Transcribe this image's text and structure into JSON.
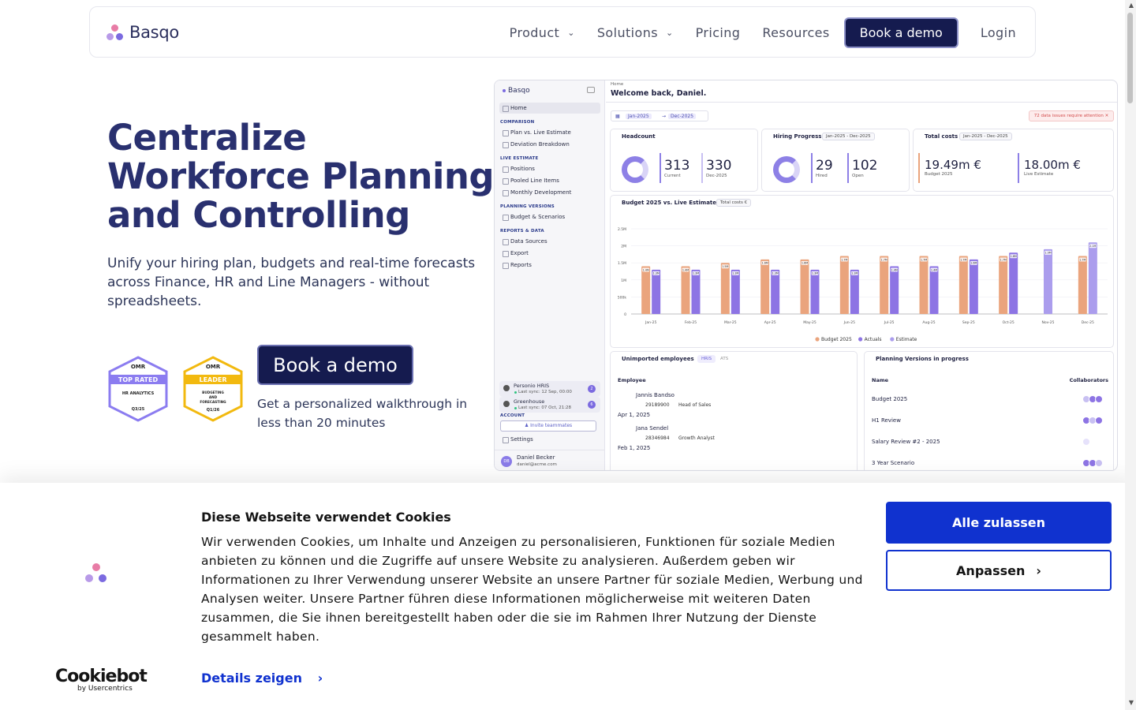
{
  "nav": {
    "brand": "Basqo",
    "items": [
      "Product",
      "Solutions",
      "Pricing",
      "Resources"
    ],
    "demo_label": "Book a demo",
    "login_label": "Login"
  },
  "hero": {
    "title": "Centralize Workforce Planning and Controlling",
    "subtitle": "Unify your hiring plan, budgets and real-time forecasts across Finance, HR and Line Managers - without spreadsheets.",
    "cta_label": "Book a demo",
    "cta_note": "Get a personalized walkthrough in less than 20 minutes",
    "badges": [
      {
        "brand": "OMR",
        "title": "TOP RATED",
        "category": "HR ANALYTICS",
        "period": "Q3/25",
        "color": "#8b7cf0"
      },
      {
        "brand": "OMR",
        "title": "LEADER",
        "category": "BUDGETING AND FORECASTING",
        "period": "Q1/26",
        "color": "#f2b90f"
      }
    ]
  },
  "mock": {
    "brand": "Basqo",
    "sidebar": {
      "home": "Home",
      "sections": [
        {
          "title": "COMPARISON",
          "items": [
            "Plan vs. Live Estimate",
            "Deviation Breakdown"
          ]
        },
        {
          "title": "LIVE ESTIMATE",
          "items": [
            "Positions",
            "Pooled Line Items",
            "Monthly Development"
          ]
        },
        {
          "title": "PLANNING VERSIONS",
          "items": [
            "Budget & Scenarios"
          ]
        },
        {
          "title": "REPORTS & DATA",
          "items": [
            "Data Sources",
            "Export",
            "Reports"
          ]
        }
      ],
      "integrations": [
        {
          "name": "Personio HRIS",
          "sync": "Last sync: 12 Sep, 00:00",
          "count": "2"
        },
        {
          "name": "Greenhouse",
          "sync": "Last sync: 07 Oct, 21:28",
          "count": "6"
        }
      ],
      "account_title": "ACCOUNT",
      "invite_label": "Invite teammates",
      "settings_label": "Settings",
      "user": {
        "initials": "DB",
        "name": "Daniel Becker",
        "email": "daniel@acme.com"
      }
    },
    "breadcrumb": "Home",
    "welcome": "Welcome back, Daniel.",
    "date_from": "Jan-2025",
    "date_to": "Dec-2025",
    "alert": "72 data issues require attention",
    "headcount": {
      "title": "Headcount",
      "current": "313",
      "current_label": "Current",
      "target": "330",
      "target_label": "Dec-2025"
    },
    "hiring": {
      "title": "Hiring Progress",
      "range": "Jan-2025 - Dec-2025",
      "hired": "29",
      "hired_label": "Hired",
      "open": "102",
      "open_label": "Open"
    },
    "costs": {
      "title": "Total costs",
      "range": "Jan-2025 - Dec-2025",
      "budget": "19.49m €",
      "budget_label": "Budget 2025",
      "live": "18.00m €",
      "live_label": "Live Estimate"
    },
    "chart_title": "Budget 2025 vs. Live Estimate",
    "chart_pill": "Total costs €",
    "unimported": {
      "title": "Unimported employees",
      "tabs": [
        "HRIS",
        "ATS"
      ],
      "column": "Employee",
      "rows": [
        {
          "name": "Jannis Bandso",
          "id": "29189900",
          "role": "Head of Sales",
          "date": "Apr 1, 2025"
        },
        {
          "name": "Jana Sendel",
          "id": "28346984",
          "role": "Growth Analyst",
          "date": "Feb 1, 2025"
        }
      ]
    },
    "planning": {
      "title": "Planning Versions in progress",
      "col_name": "Name",
      "col_collab": "Collaborators",
      "rows": [
        "Budget 2025",
        "H1 Review",
        "Salary Review #2 - 2025",
        "3 Year Scenario"
      ]
    }
  },
  "chart_data": {
    "type": "bar",
    "title": "Budget 2025 vs. Live Estimate",
    "categories": [
      "Jan-25",
      "Feb-25",
      "Mar-25",
      "Apr-25",
      "May-25",
      "Jun-25",
      "Jul-25",
      "Aug-25",
      "Sep-25",
      "Oct-25",
      "Nov-25",
      "Dec-25"
    ],
    "series": [
      {
        "name": "Budget 2025",
        "color": "#eaa47d",
        "values": [
          1.4,
          1.4,
          1.5,
          1.6,
          1.6,
          1.7,
          1.7,
          1.7,
          1.7,
          1.7,
          null,
          1.7
        ],
        "labels": [
          "1.4M",
          "1.4M",
          "1.5M",
          "1.6M",
          "1.6M",
          "1.7M",
          "1.7M",
          "1.7M",
          "1.7M",
          "1.7M",
          "",
          "1.7M"
        ]
      },
      {
        "name": "Actuals",
        "color": "#8d74e4",
        "values": [
          1.3,
          1.3,
          1.3,
          1.3,
          1.3,
          1.3,
          1.4,
          1.4,
          1.6,
          1.8,
          null,
          null
        ],
        "labels": [
          "1.3M",
          "1.3M",
          "1.3M",
          "1.3M",
          "1.3M",
          "1.3M",
          "1.4M",
          "1.4M",
          "1.6M",
          "1.8M",
          "",
          ""
        ]
      },
      {
        "name": "Estimate",
        "color": "#ab9ded",
        "values": [
          null,
          null,
          null,
          null,
          null,
          null,
          null,
          null,
          null,
          null,
          1.9,
          2.1
        ],
        "labels": [
          "",
          "",
          "",
          "",
          "",
          "",
          "",
          "",
          "",
          "",
          "1.9M",
          "2.1M"
        ]
      }
    ],
    "y_ticks": [
      "0",
      "500k",
      "1M",
      "1.5M",
      "2M",
      "2.5M"
    ],
    "ylim": [
      0,
      2.5
    ]
  },
  "cookie": {
    "title": "Diese Webseite verwendet Cookies",
    "body": "Wir verwenden Cookies, um Inhalte und Anzeigen zu personalisieren, Funktionen für soziale Medien anbieten zu können und die Zugriffe auf unsere Website zu analysieren. Außerdem geben wir Informationen zu Ihrer Verwendung unserer Website an unsere Partner für soziale Medien, Werbung und Analysen weiter. Unsere Partner führen diese Informationen möglicherweise mit weiteren Daten zusammen, die Sie ihnen bereitgestellt haben oder die sie im Rahmen Ihrer Nutzung der Dienste gesammelt haben.",
    "details_label": "Details zeigen",
    "allow_label": "Alle zulassen",
    "adjust_label": "Anpassen",
    "brand": "Cookiebot",
    "brand_sub": "by Usercentrics"
  }
}
